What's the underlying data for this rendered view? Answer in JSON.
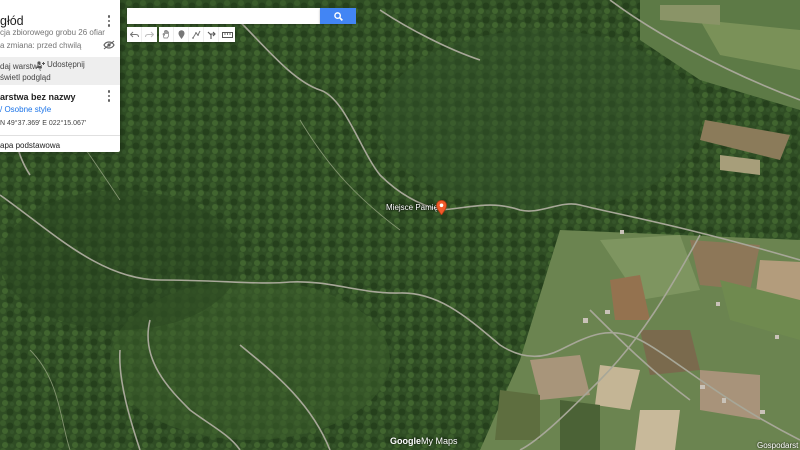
{
  "panel": {
    "title": "głód",
    "description": "cja zbiorowego grobu 26 ofiar",
    "last_change": "a zmiana: przed chwilą",
    "add_layer": "daj warstwę",
    "share": "Udostępnij",
    "preview": "świetl podgląd",
    "layer_name": "arstwa bez nazwy",
    "style_link": "/ Osobne style",
    "coord": "N 49°37.369' E 022°15.067'",
    "base_map": "apa podstawowa"
  },
  "search": {
    "placeholder": "",
    "value": ""
  },
  "toolbar": {
    "buttons": [
      "undo-icon",
      "redo-icon",
      "hand-icon",
      "add-marker-icon",
      "draw-line-icon",
      "directions-icon",
      "ruler-icon"
    ]
  },
  "map": {
    "marker_label": "Miejsce Pamięci",
    "marker_color": "#f0592a",
    "place_label": "Gospodarst",
    "logo_google": "Google",
    "logo_mymaps": "My Maps"
  }
}
